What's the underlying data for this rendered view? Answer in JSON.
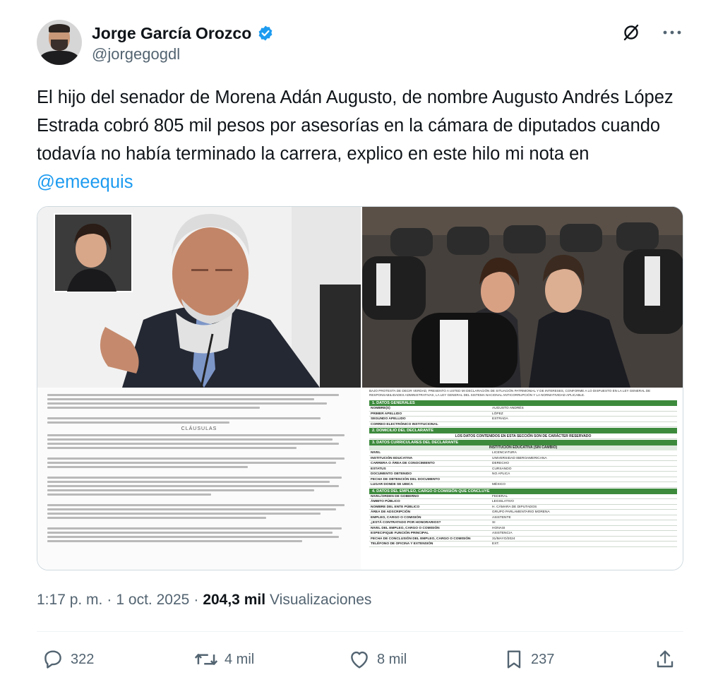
{
  "author": {
    "display_name": "Jorge García Orozco",
    "handle": "@jorgegogdl",
    "verified": true
  },
  "tweet": {
    "text_before_mention": "El hijo del senador de Morena Adán Augusto, de nombre Augusto Andrés López Estrada cobró 805 mil pesos por asesorías en la cámara de diputados cuando todavía no había terminado la carrera, explico en este hilo mi nota en ",
    "mention": "@emeequis"
  },
  "meta": {
    "time": "1:17 p. m.",
    "separator": "·",
    "date": "1 oct. 2025",
    "views_count": "204,3 mil",
    "views_label": "Visualizaciones"
  },
  "actions": {
    "replies": "322",
    "reposts": "4 mil",
    "likes": "8 mil",
    "bookmarks": "237"
  },
  "icons": {
    "verified": "verified-badge-icon",
    "grok": "grok-icon",
    "more": "more-icon",
    "reply": "reply-icon",
    "repost": "repost-icon",
    "like": "like-icon",
    "bookmark": "bookmark-icon",
    "share": "share-icon"
  },
  "colors": {
    "accent": "#1d9bf0",
    "text_primary": "#0f1419",
    "text_secondary": "#536471",
    "border": "#cfd9de",
    "form_green": "#3d8a3d"
  },
  "document_left": {
    "title": "CLÁUSULAS"
  },
  "document_right": {
    "header": "BAJO PROTESTA DE DECIR VERDAD, PRESENTO A USTED MI DECLARACIÓN DE SITUACIÓN PATRIMONIAL Y DE INTERESES, CONFORME A LO DISPUESTO EN LA LEY GENERAL DE RESPONSABILIDADES ADMINISTRATIVAS, LA LEY GENERAL DEL SISTEMA NACIONAL ANTICORRUPCIÓN Y LA NORMATIVIDAD APLICABLE.",
    "section1": "1. DATOS GENERALES",
    "general": [
      {
        "k": "NOMBRE(S)",
        "v": "AUGUSTO ANDRÉS"
      },
      {
        "k": "PRIMER APELLIDO",
        "v": "LÓPEZ"
      },
      {
        "k": "SEGUNDO APELLIDO",
        "v": "ESTRADA"
      },
      {
        "k": "CORREO ELECTRÓNICO INSTITUCIONAL",
        "v": ""
      }
    ],
    "section2": "2. DOMICILIO DEL DECLARANTE",
    "reserved_note": "LOS DATOS CONTENIDOS EN ESTA SECCIÓN SON DE CARÁCTER RESERVADO",
    "section3": "3. DATOS CURRICULARES DEL DECLARANTE",
    "edu_subhead": "INSTITUCIÓN EDUCATIVA (SIN CAMBIO)",
    "education": [
      {
        "k": "NIVEL",
        "v": "LICENCIATURA"
      },
      {
        "k": "INSTITUCIÓN EDUCATIVA",
        "v": "UNIVERSIDAD IBEROAMERICANA"
      },
      {
        "k": "CARRERA O ÁREA DE CONOCIMIENTO",
        "v": "DERECHO"
      },
      {
        "k": "ESTATUS",
        "v": "CURSANDO"
      },
      {
        "k": "DOCUMENTO OBTENIDO",
        "v": "NO APLICA"
      },
      {
        "k": "FECHA DE OBTENCIÓN DEL DOCUMENTO",
        "v": ""
      },
      {
        "k": "LUGAR DONDE SE UBICA",
        "v": "MÉXICO"
      }
    ],
    "section4": "4. DATOS DEL EMPLEO, CARGO O COMISIÓN QUE CONCLUYE",
    "employment": [
      {
        "k": "NIVEL/ORDEN DE GOBIERNO",
        "v": "FEDERAL"
      },
      {
        "k": "ÁMBITO PÚBLICO",
        "v": "LEGISLATIVO"
      },
      {
        "k": "NOMBRE DEL ENTE PÚBLICO",
        "v": "H. CÁMARA DE DIPUTADOS"
      },
      {
        "k": "ÁREA DE ADSCRIPCIÓN",
        "v": "GRUPO PARLAMENTARIO MORENA"
      },
      {
        "k": "EMPLEO, CARGO O COMISIÓN",
        "v": "ASISTENTE"
      },
      {
        "k": "¿ESTÁ CONTRATADO POR HONORARIOS?",
        "v": "SI"
      },
      {
        "k": "NIVEL DEL EMPLEO, CARGO O COMISIÓN",
        "v": "HONASI"
      },
      {
        "k": "ESPECIFIQUE FUNCIÓN PRINCIPAL",
        "v": "ASISTENCIA"
      },
      {
        "k": "FECHA DE CONCLUSIÓN DEL EMPLEO, CARGO O COMISIÓN",
        "v": "31/MAYO/2024"
      },
      {
        "k": "TELÉFONO DE OFICINA Y EXTENSIÓN",
        "v": "EXT."
      }
    ]
  }
}
